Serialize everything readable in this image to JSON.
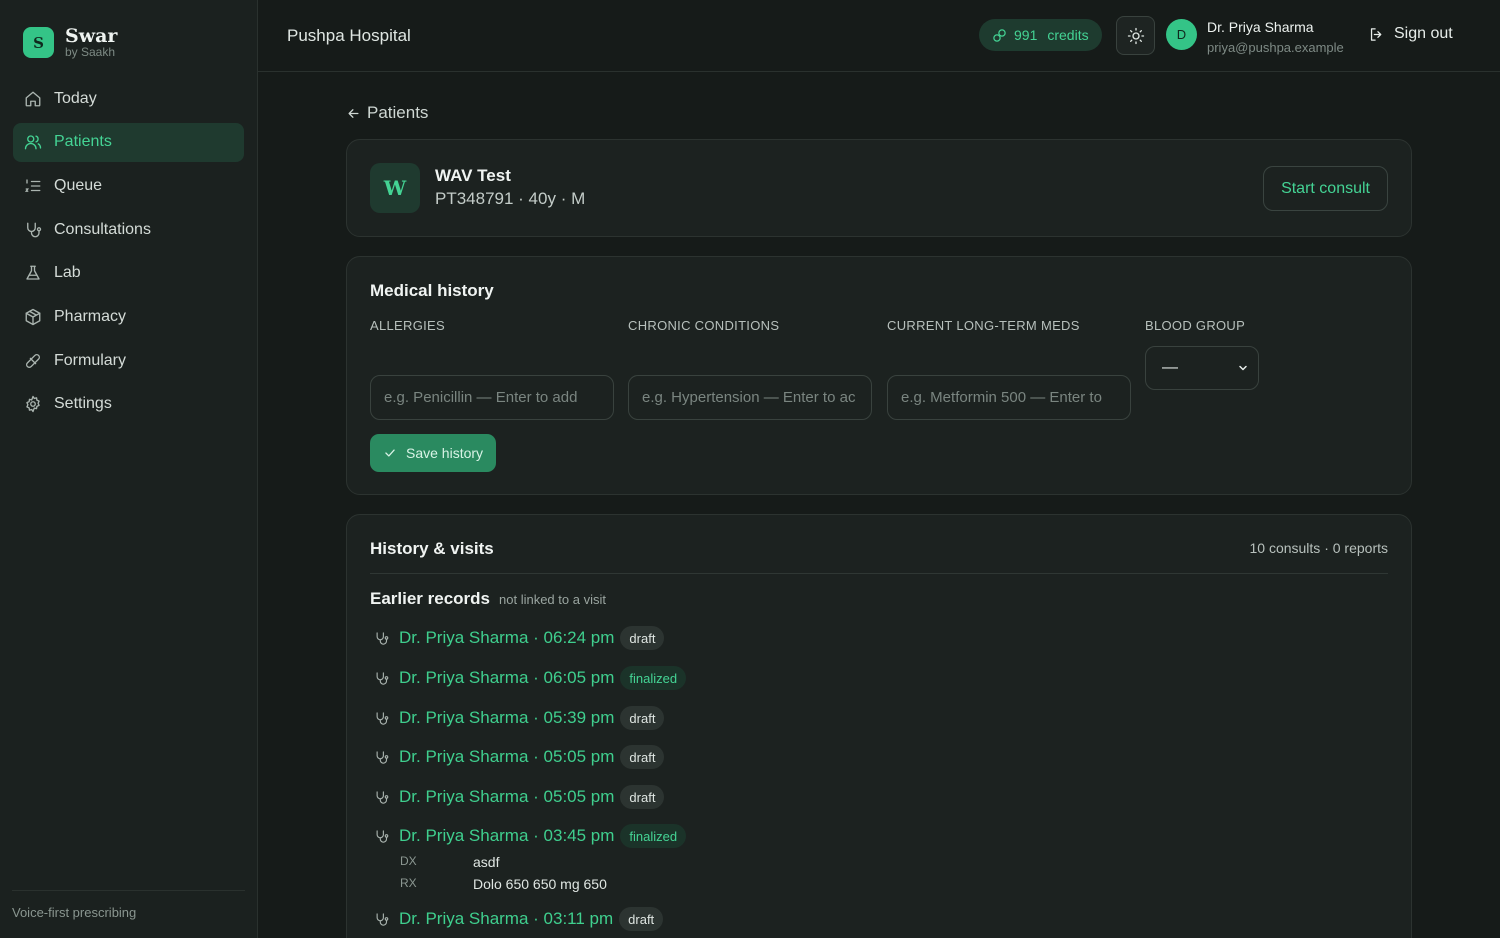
{
  "brand": {
    "logo_letter": "S",
    "name": "Swar",
    "sub": "by Saakh"
  },
  "nav": [
    {
      "label": "Today",
      "icon": "home-icon",
      "active": false
    },
    {
      "label": "Patients",
      "icon": "users-icon",
      "active": true
    },
    {
      "label": "Queue",
      "icon": "list-icon",
      "active": false
    },
    {
      "label": "Consultations",
      "icon": "stethoscope-icon",
      "active": false
    },
    {
      "label": "Lab",
      "icon": "flask-icon",
      "active": false
    },
    {
      "label": "Pharmacy",
      "icon": "box-icon",
      "active": false
    },
    {
      "label": "Formulary",
      "icon": "pill-icon",
      "active": false
    },
    {
      "label": "Settings",
      "icon": "gear-icon",
      "active": false
    }
  ],
  "sidebar_footer": "Voice-first prescribing",
  "topbar": {
    "hospital": "Pushpa Hospital",
    "credits_value": "991",
    "credits_label": "credits",
    "avatar_letter": "D",
    "user_name": "Dr. Priya Sharma",
    "user_email": "priya@pushpa.example",
    "signout": "Sign out"
  },
  "back_label": "Patients",
  "patient": {
    "initial": "W",
    "name": "WAV Test",
    "meta": "PT348791 · 40y · M",
    "start_consult": "Start consult"
  },
  "medical_history": {
    "title": "Medical history",
    "allergies_label": "ALLERGIES",
    "allergies_placeholder": "e.g. Penicillin — Enter to add",
    "chronic_label": "CHRONIC CONDITIONS",
    "chronic_placeholder": "e.g. Hypertension — Enter to ac",
    "meds_label": "CURRENT LONG-TERM MEDS",
    "meds_placeholder": "e.g. Metformin 500 — Enter to",
    "blood_label": "BLOOD GROUP",
    "blood_value": "—",
    "save": "Save history"
  },
  "visits": {
    "title": "History & visits",
    "counts": "10 consults · 0 reports",
    "earlier_title": "Earlier records",
    "earlier_sub": "not linked to a visit",
    "items": [
      {
        "label": "Dr. Priya Sharma · 06:24 pm",
        "status": "draft"
      },
      {
        "label": "Dr. Priya Sharma · 06:05 pm",
        "status": "finalized"
      },
      {
        "label": "Dr. Priya Sharma · 05:39 pm",
        "status": "draft"
      },
      {
        "label": "Dr. Priya Sharma · 05:05 pm",
        "status": "draft"
      },
      {
        "label": "Dr. Priya Sharma · 05:05 pm",
        "status": "draft"
      },
      {
        "label": "Dr. Priya Sharma · 03:45 pm",
        "status": "finalized"
      },
      {
        "label": "Dr. Priya Sharma · 03:11 pm",
        "status": "draft"
      }
    ],
    "detail": {
      "dx_key": "DX",
      "dx_value": "asdf",
      "rx_key": "RX",
      "rx_value": "Dolo 650 650 mg 650"
    }
  },
  "colors": {
    "accent": "#44d394",
    "background": "#161b19",
    "sidebar": "#1b211f",
    "card": "#1c2220"
  }
}
